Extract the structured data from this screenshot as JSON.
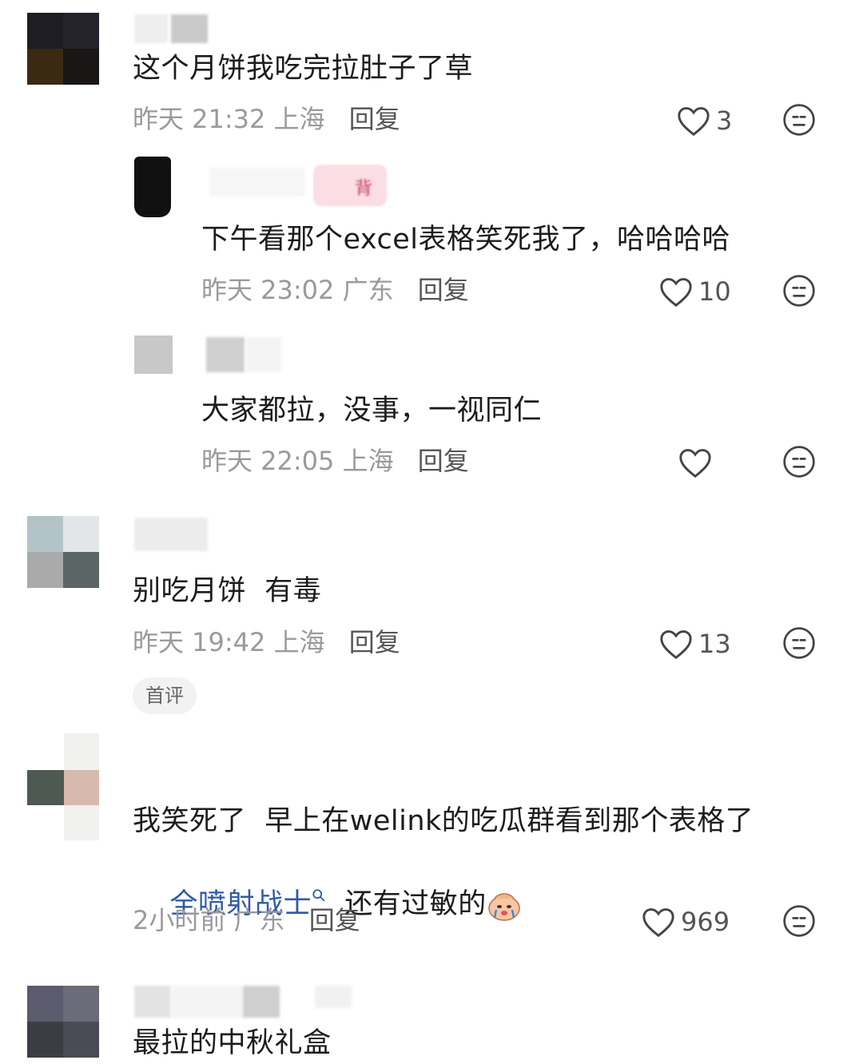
{
  "colors": {
    "text": "#1c1c1c",
    "meta": "#9a9a9a",
    "link": "#2f5aa8"
  },
  "comments": [
    {
      "text": "这个月饼我吃完拉肚子了草",
      "time": "昨天 21:32",
      "location": "上海",
      "reply": "回复",
      "likes": "3"
    },
    {
      "text": "下午看那个excel表格笑死我了，哈哈哈哈",
      "time": "昨天 23:02",
      "location": "广东",
      "reply": "回复",
      "likes": "10",
      "badge": "背"
    },
    {
      "text": "大家都拉，没事，一视同仁",
      "time": "昨天 22:05",
      "location": "上海",
      "reply": "回复",
      "likes": ""
    },
    {
      "text": "别吃月饼  有毒",
      "time": "昨天 19:42",
      "location": "上海",
      "reply": "回复",
      "likes": "13",
      "tag": "首评"
    },
    {
      "text": "我笑死了  早上在welink的吃瓜群看到那个表格了",
      "hashtag": "全喷射战士",
      "tail": "  还有过敏的",
      "time": "2小时前",
      "location": "广东",
      "reply": "回复",
      "likes": "969"
    },
    {
      "text": "最拉的中秋礼盒"
    }
  ],
  "icons": {
    "like": "heart-icon",
    "emoji": "emoji-face-icon",
    "search": "search-icon",
    "sticker": "crying-sticker-icon"
  }
}
